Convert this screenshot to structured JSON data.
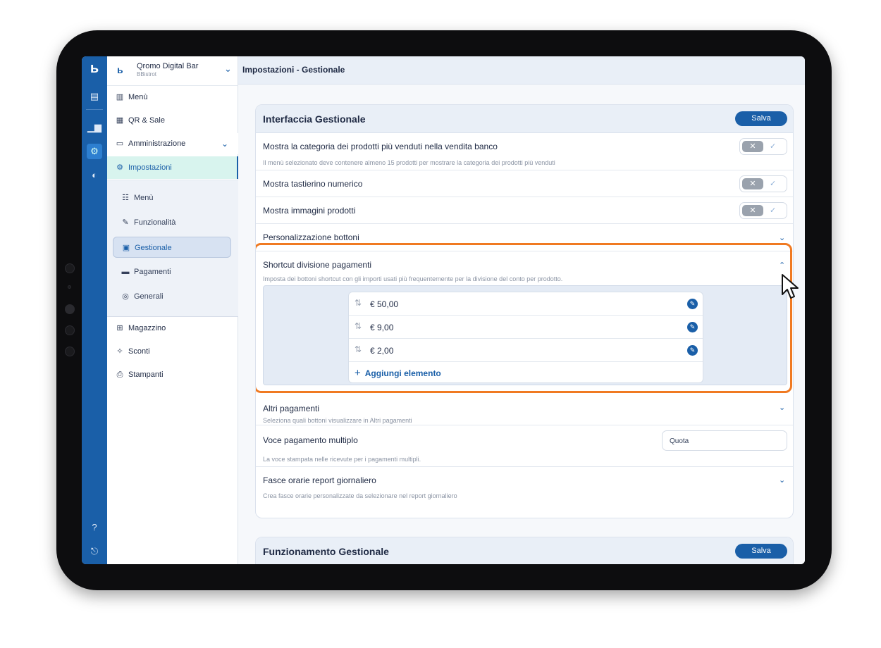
{
  "app": {
    "venue_name": "Qromo Digital Bar",
    "venue_sub": "BBistrot",
    "page_title": "Impostazioni - Gestionale"
  },
  "sidebar": {
    "items": [
      {
        "label": "Menù",
        "icon": "menu-book-icon"
      },
      {
        "label": "QR & Sale",
        "icon": "qr-code-icon"
      },
      {
        "label": "Amministrazione",
        "icon": "admin-icon"
      },
      {
        "label": "Impostazioni",
        "icon": "settings-icon"
      }
    ],
    "sub_items": [
      {
        "label": "Menù",
        "icon": "menu-icon"
      },
      {
        "label": "Funzionalità",
        "icon": "features-icon"
      },
      {
        "label": "Gestionale",
        "icon": "management-icon"
      },
      {
        "label": "Pagamenti",
        "icon": "payments-icon"
      },
      {
        "label": "Generali",
        "icon": "general-icon"
      }
    ],
    "bottom_items": [
      {
        "label": "Magazzino",
        "icon": "warehouse-icon"
      },
      {
        "label": "Sconti",
        "icon": "discount-icon"
      },
      {
        "label": "Stampanti",
        "icon": "printer-icon"
      }
    ]
  },
  "card1": {
    "title": "Interfaccia Gestionale",
    "save_label": "Salva",
    "rows": {
      "bestsellers_title": "Mostra la categoria dei prodotti più venduti nella vendita banco",
      "bestsellers_desc": "Il menù selezionato deve contenere almeno 15 prodotti per mostrare la categoria dei prodotti più venduti",
      "numpad_title": "Mostra tastierino numerico",
      "images_title": "Mostra immagini prodotti",
      "buttons_title": "Personalizzazione bottoni",
      "shortcut_title": "Shortcut divisione pagamenti",
      "shortcut_desc": "Imposta dei bottoni shortcut con gli importi usati più frequentemente per la divisione del conto per prodotto.",
      "other_title": "Altri pagamenti",
      "other_desc": "Seleziona quali bottoni visualizzare in Altri pagamenti",
      "multi_title": "Voce pagamento multiplo",
      "multi_value": "Quota",
      "multi_desc": "La voce stampata nelle ricevute per i pagamenti multipli.",
      "slots_title": "Fasce orarie report giornaliero",
      "slots_desc": "Crea fasce orarie personalizzate da selezionare nel report giornaliero"
    },
    "toggles": {
      "bestsellers": false,
      "numpad": false,
      "images": false
    },
    "shortcut_amounts": [
      "€ 50,00",
      "€ 9,00",
      "€ 2,00"
    ],
    "add_label": "Aggiungi elemento"
  },
  "card2": {
    "title": "Funzionamento Gestionale",
    "save_label": "Salva"
  },
  "colors": {
    "accent": "#1a5fa8",
    "highlight": "#f07a22",
    "selected_bg": "#d8f4ee"
  }
}
